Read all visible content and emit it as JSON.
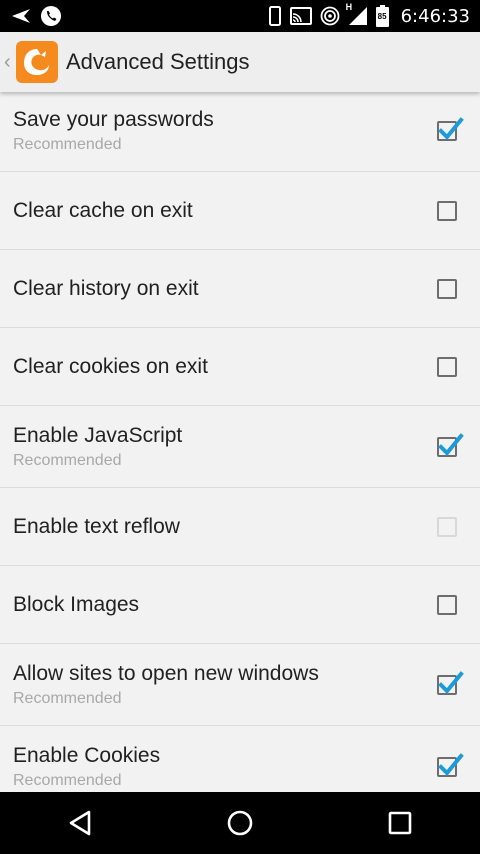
{
  "status_bar": {
    "time": "6:46:33",
    "icons": [
      "send-icon",
      "phone-icon",
      "vibrate-icon",
      "cast-icon",
      "hotspot-icon",
      "h-icon",
      "signal-icon",
      "battery-icon"
    ],
    "network_label": "H",
    "battery_label": "85"
  },
  "app_bar": {
    "title": "Advanced Settings",
    "logo_color": "#f58a1f"
  },
  "settings": [
    {
      "title": "Save your passwords",
      "subtitle": "Recommended",
      "checked": true,
      "enabled": true
    },
    {
      "title": "Clear cache on exit",
      "subtitle": "",
      "checked": false,
      "enabled": true
    },
    {
      "title": "Clear history on exit",
      "subtitle": "",
      "checked": false,
      "enabled": true
    },
    {
      "title": "Clear cookies on exit",
      "subtitle": "",
      "checked": false,
      "enabled": true
    },
    {
      "title": "Enable JavaScript",
      "subtitle": "Recommended",
      "checked": true,
      "enabled": true
    },
    {
      "title": "Enable text reflow",
      "subtitle": "",
      "checked": false,
      "enabled": false
    },
    {
      "title": "Block Images",
      "subtitle": "",
      "checked": false,
      "enabled": true
    },
    {
      "title": "Allow sites to open new windows",
      "subtitle": "Recommended",
      "checked": true,
      "enabled": true
    },
    {
      "title": "Enable Cookies",
      "subtitle": "Recommended",
      "checked": true,
      "enabled": true
    }
  ],
  "colors": {
    "check_accent": "#1e9bd7",
    "background": "#f2f2f2"
  },
  "nav_bar": {
    "buttons": [
      "back-icon",
      "home-icon",
      "recents-icon"
    ]
  }
}
